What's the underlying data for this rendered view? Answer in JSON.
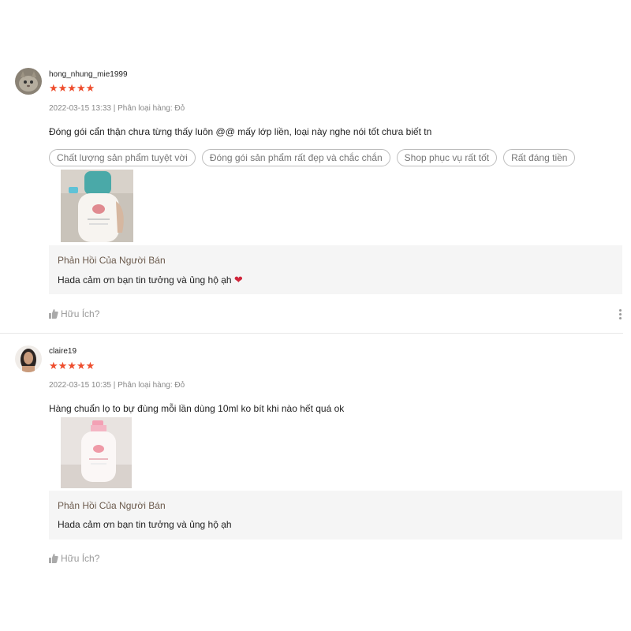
{
  "reviews": [
    {
      "username": "hong_nhung_mie1999",
      "stars": "★★★★★",
      "rating": 5,
      "meta": "2022-03-15 13:33 | Phân loại hàng: Đỏ",
      "comment": "Đóng gói cẩn thận chưa từng thấy luôn @@ mấy lớp liền, loại này nghe nói tốt chưa biết tn",
      "tags": [
        "Chất lượng sản phẩm tuyệt vời",
        "Đóng gói sản phẩm rất đẹp và chắc chắn",
        "Shop phục vụ rất tốt",
        "Rất đáng tiền"
      ],
      "reply_title": "Phản Hồi Của Người Bán",
      "reply_text": "Hada cảm ơn bạn tin tưởng và ủng hộ ạh",
      "helpful_label": "Hữu Ích?"
    },
    {
      "username": "claire19",
      "stars": "★★★★★",
      "rating": 5,
      "meta": "2022-03-15 10:35 | Phân loại hàng: Đỏ",
      "comment": "Hàng chuẩn lọ to bự đùng mỗi lần dùng 10ml ko bít khi nào hết quá ok",
      "reply_title": "Phản Hồi Của Người Bán",
      "reply_text": "Hada cảm ơn bạn tin tưởng và ủng hộ ạh",
      "helpful_label": "Hữu Ích?"
    }
  ],
  "colors": {
    "star": "#ee4d2d",
    "heart": "#d0253b",
    "reply_bg": "#f5f5f5",
    "reply_title": "#6b5a4c"
  },
  "icons": {
    "thumb": "thumbs-up-icon",
    "more": "more-vertical-icon",
    "heart": "heart-icon"
  }
}
